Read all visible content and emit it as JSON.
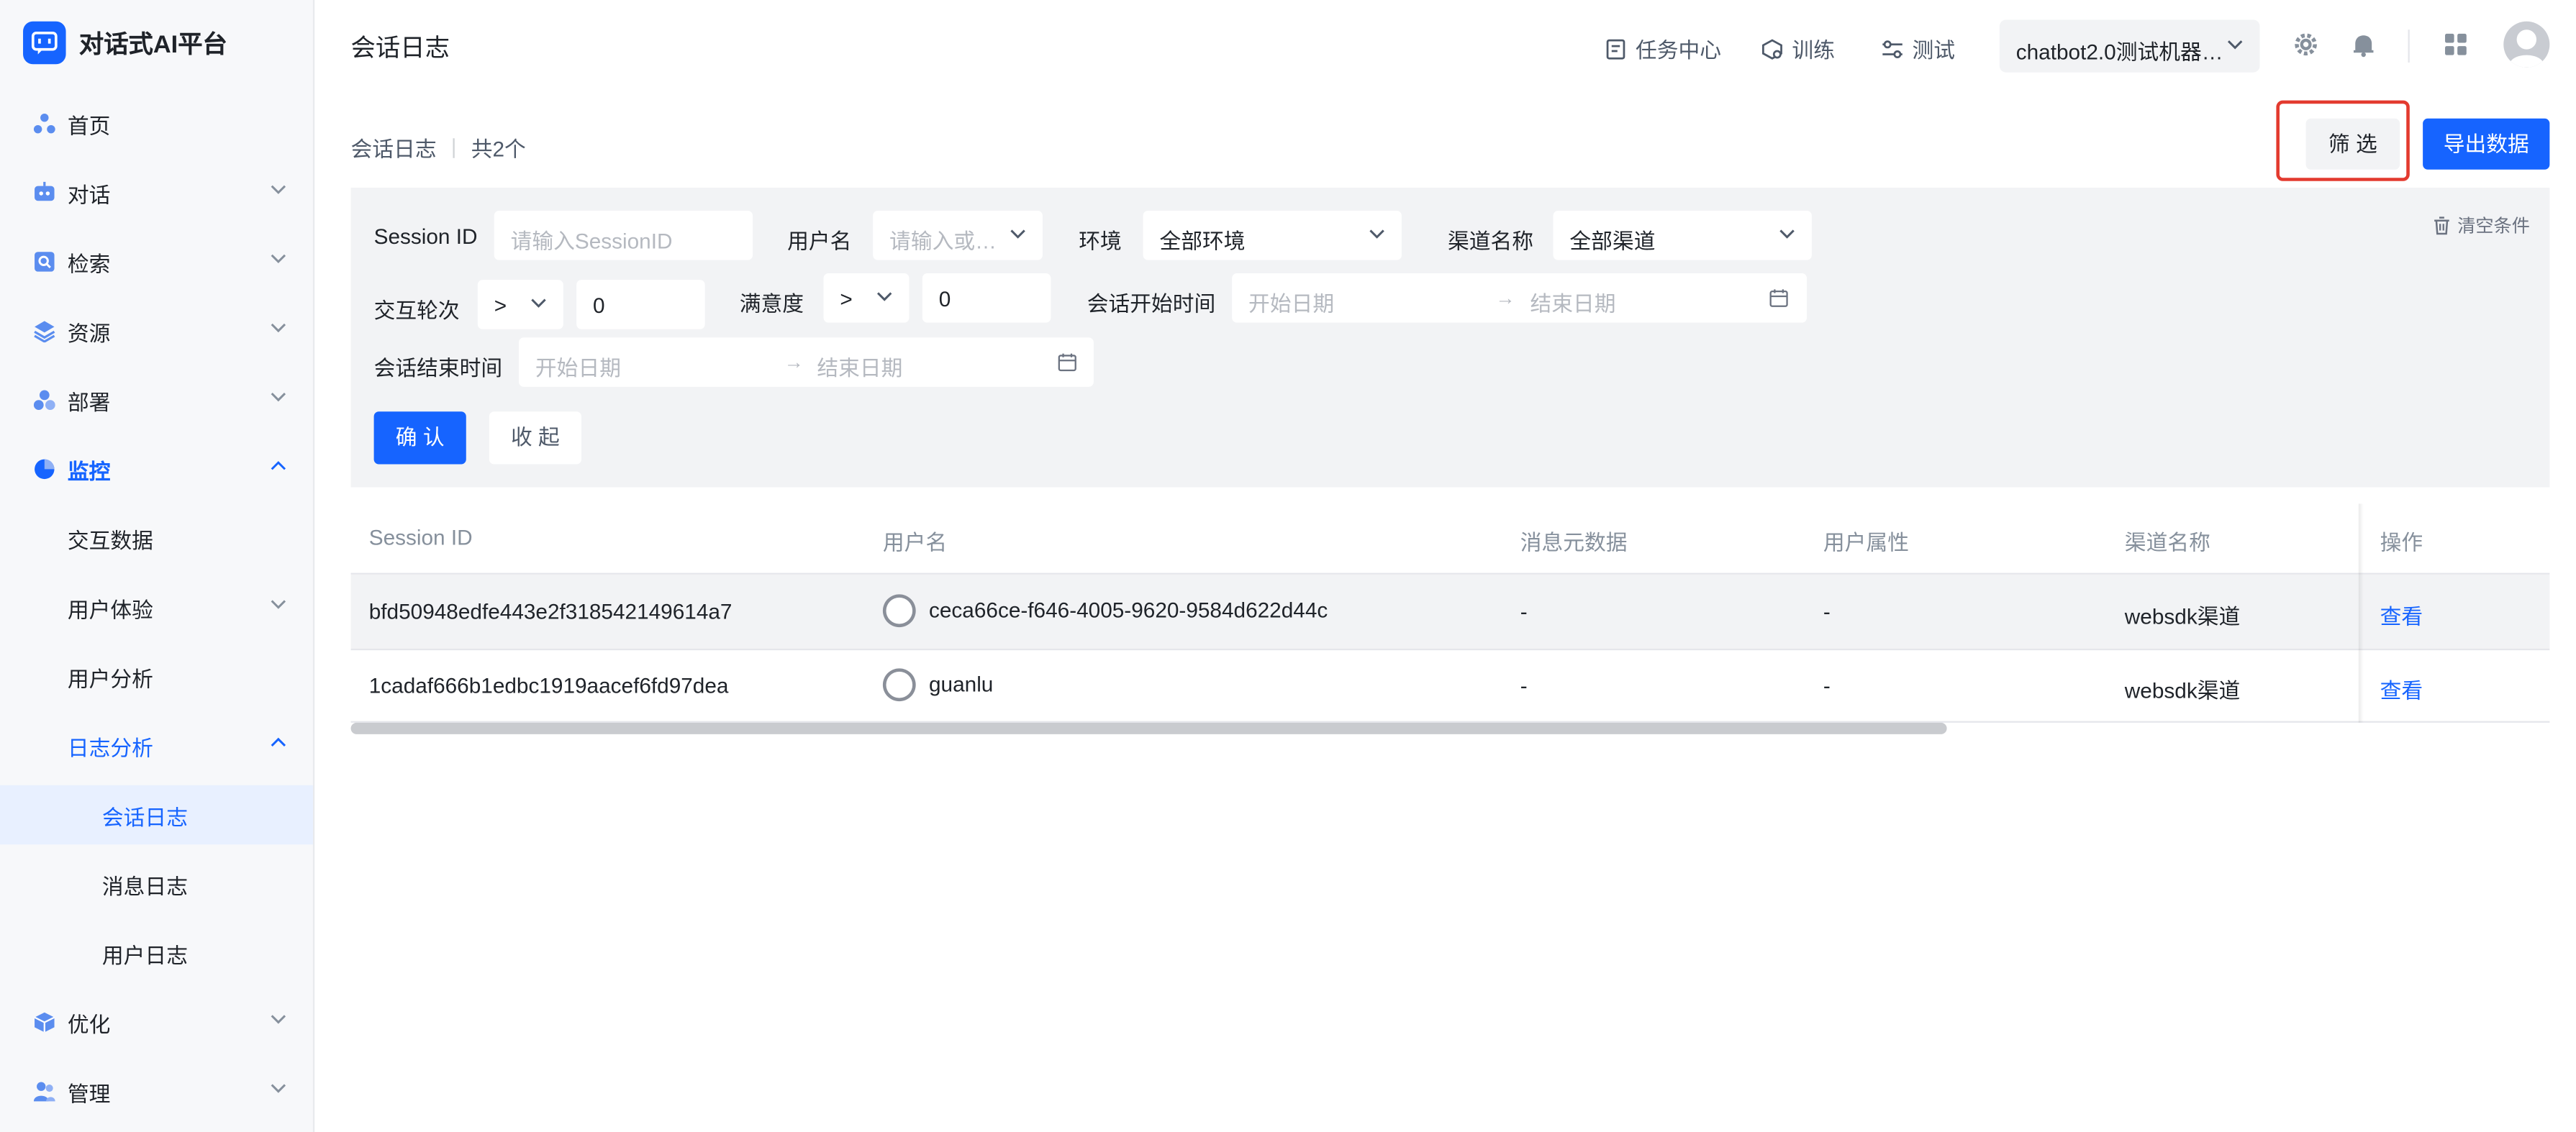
{
  "app": {
    "name": "对话式AI平台"
  },
  "sidebar": {
    "items": [
      {
        "label": "首页",
        "icon": "home-icon"
      },
      {
        "label": "对话",
        "icon": "robot-icon"
      },
      {
        "label": "检索",
        "icon": "search-doc-icon"
      },
      {
        "label": "资源",
        "icon": "layers-icon"
      },
      {
        "label": "部署",
        "icon": "deploy-icon"
      },
      {
        "label": "监控",
        "icon": "pie-chart-icon"
      },
      {
        "label": "交互数据"
      },
      {
        "label": "用户体验"
      },
      {
        "label": "用户分析"
      },
      {
        "label": "日志分析"
      },
      {
        "label": "会话日志"
      },
      {
        "label": "消息日志"
      },
      {
        "label": "用户日志"
      },
      {
        "label": "优化",
        "icon": "cube-icon"
      },
      {
        "label": "管理",
        "icon": "users-icon"
      }
    ]
  },
  "header": {
    "title": "会话日志",
    "task_center": "任务中心",
    "train": "训练",
    "test": "测试",
    "bot_select": "chatbot2.0测试机器…"
  },
  "toolbar": {
    "breadcrumb": "会话日志",
    "count": "共2个",
    "filter_label": "筛 选",
    "export_label": "导出数据",
    "clear_label": "清空条件"
  },
  "filters": {
    "session_id_label": "Session ID",
    "session_id_placeholder": "请输入SessionID",
    "username_label": "用户名",
    "username_placeholder": "请输入或…",
    "env_label": "环境",
    "env_value": "全部环境",
    "channel_label": "渠道名称",
    "channel_value": "全部渠道",
    "turns_label": "交互轮次",
    "turns_op": ">",
    "turns_value": "0",
    "satisfaction_label": "满意度",
    "satisfaction_op": ">",
    "satisfaction_value": "0",
    "start_time_label": "会话开始时间",
    "end_time_label": "会话结束时间",
    "start_date_placeholder": "开始日期",
    "end_date_placeholder": "结束日期",
    "confirm_label": "确 认",
    "collapse_label": "收 起"
  },
  "table": {
    "columns": [
      "Session ID",
      "用户名",
      "消息元数据",
      "用户属性",
      "渠道名称",
      "操作"
    ],
    "rows": [
      {
        "session_id": "bfd50948edfe443e2f318542149614a7",
        "user": "ceca66ce-f646-4005-9620-9584d622d44c",
        "metadata": "-",
        "attributes": "-",
        "channel": "websdk渠道",
        "action": "查看"
      },
      {
        "session_id": "1cadaf666b1edbc1919aacef6fd97dea",
        "user": "guanlu",
        "metadata": "-",
        "attributes": "-",
        "channel": "websdk渠道",
        "action": "查看"
      }
    ]
  },
  "colors": {
    "accent": "#1664ff",
    "highlight_border": "#e33a2f"
  }
}
